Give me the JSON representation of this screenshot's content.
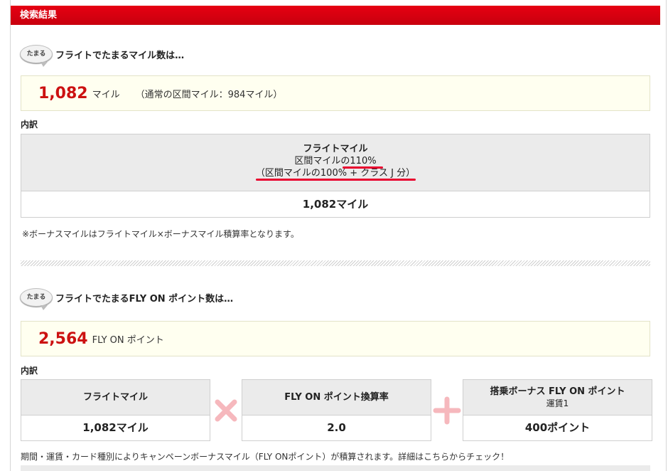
{
  "header": {
    "title": "検索結果"
  },
  "miles_section": {
    "badge": "たまる",
    "title": "フライトでたまるマイル数は…",
    "total_value": "1,082",
    "total_unit": "マイル",
    "normal_note": "（通常の区間マイル：984マイル）",
    "breakdown_label": "内訳",
    "breakdown": {
      "head_title": "フライトマイル",
      "head_line2": "区間マイルの110%",
      "head_line3": "（区間マイルの100% + クラス J 分）",
      "value": "1,082マイル"
    },
    "bonus_note": "※ボーナスマイルはフライトマイル×ボーナスマイル積算率となります。"
  },
  "flyon_section": {
    "badge": "たまる",
    "title": "フライトでたまるFLY ON ポイント数は…",
    "total_value": "2,564",
    "total_unit": "FLY ON ポイント",
    "breakdown_label": "内訳",
    "cards": [
      {
        "head": "フライトマイル",
        "sub": "",
        "value": "1,082マイル"
      },
      {
        "head": "FLY ON ポイント換算率",
        "sub": "",
        "value": "2.0"
      },
      {
        "head": "搭乗ボーナス FLY ON ポイント",
        "sub": "運賃1",
        "value": "400ポイント"
      }
    ],
    "operators": [
      "multiply-icon",
      "plus-icon"
    ],
    "campaign_note": "期間・運賃・カード種別によりキャンペーンボーナスマイル（FLY ONポイント）が積算されます。詳細はこちらからチェック！"
  },
  "colors": {
    "accent_red": "#e60012",
    "value_red": "#cc1111",
    "operator_pink": "#f6b8bd",
    "summary_bg": "#fffff0"
  }
}
